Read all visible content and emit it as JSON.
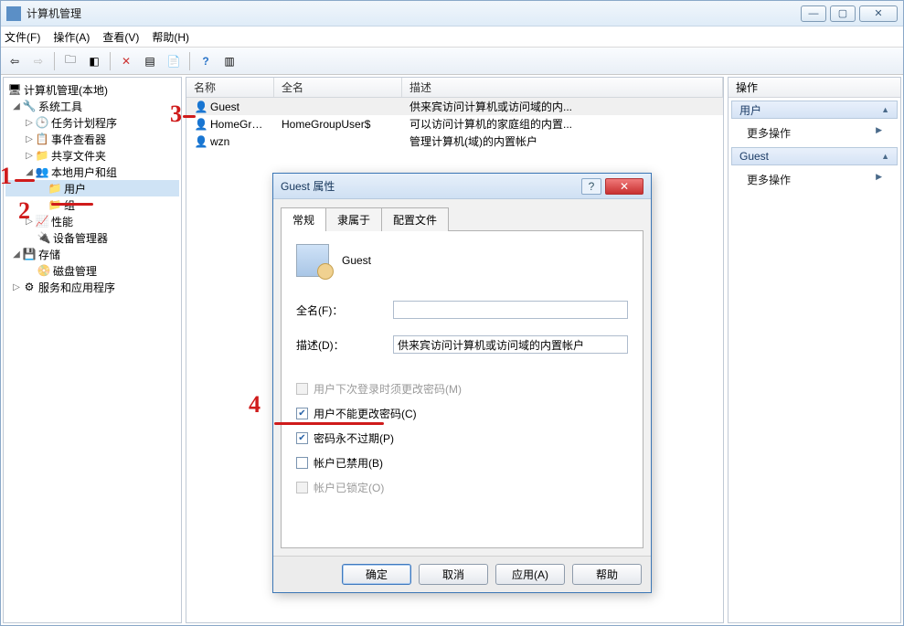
{
  "window": {
    "title": "计算机管理"
  },
  "menus": {
    "file": "文件(F)",
    "action": "操作(A)",
    "view": "查看(V)",
    "help": "帮助(H)"
  },
  "tree": {
    "root": "计算机管理(本地)",
    "system_tools": "系统工具",
    "task_scheduler": "任务计划程序",
    "event_viewer": "事件查看器",
    "shared_folders": "共享文件夹",
    "local_users": "本地用户和组",
    "users": "用户",
    "groups": "组",
    "performance": "性能",
    "device_manager": "设备管理器",
    "storage": "存储",
    "disk_mgmt": "磁盘管理",
    "services_apps": "服务和应用程序"
  },
  "columns": {
    "name": "名称",
    "fullname": "全名",
    "desc": "描述"
  },
  "users_list": [
    {
      "name": "Guest",
      "fullname": "",
      "desc": "供来宾访问计算机或访问域的内..."
    },
    {
      "name": "HomeGrou...",
      "fullname": "HomeGroupUser$",
      "desc": "可以访问计算机的家庭组的内置..."
    },
    {
      "name": "wzn",
      "fullname": "",
      "desc": "管理计算机(域)的内置帐户"
    }
  ],
  "actions": {
    "header": "操作",
    "section1": "用户",
    "more": "更多操作",
    "section2": "Guest"
  },
  "dialog": {
    "title": "Guest 属性",
    "tabs": {
      "general": "常规",
      "member": "隶属于",
      "profile": "配置文件"
    },
    "username": "Guest",
    "fullname_label": "全名(F)：",
    "fullname_value": "",
    "desc_label": "描述(D)：",
    "desc_value": "供来宾访问计算机或访问域的内置帐户",
    "chk_must_change": "用户下次登录时须更改密码(M)",
    "chk_cannot_change": "用户不能更改密码(C)",
    "chk_never_expire": "密码永不过期(P)",
    "chk_disabled": "帐户已禁用(B)",
    "chk_locked": "帐户已锁定(O)",
    "btn_ok": "确定",
    "btn_cancel": "取消",
    "btn_apply": "应用(A)",
    "btn_help": "帮助"
  },
  "annotations": {
    "n1": "1",
    "n2": "2",
    "n3": "3",
    "n4": "4"
  }
}
